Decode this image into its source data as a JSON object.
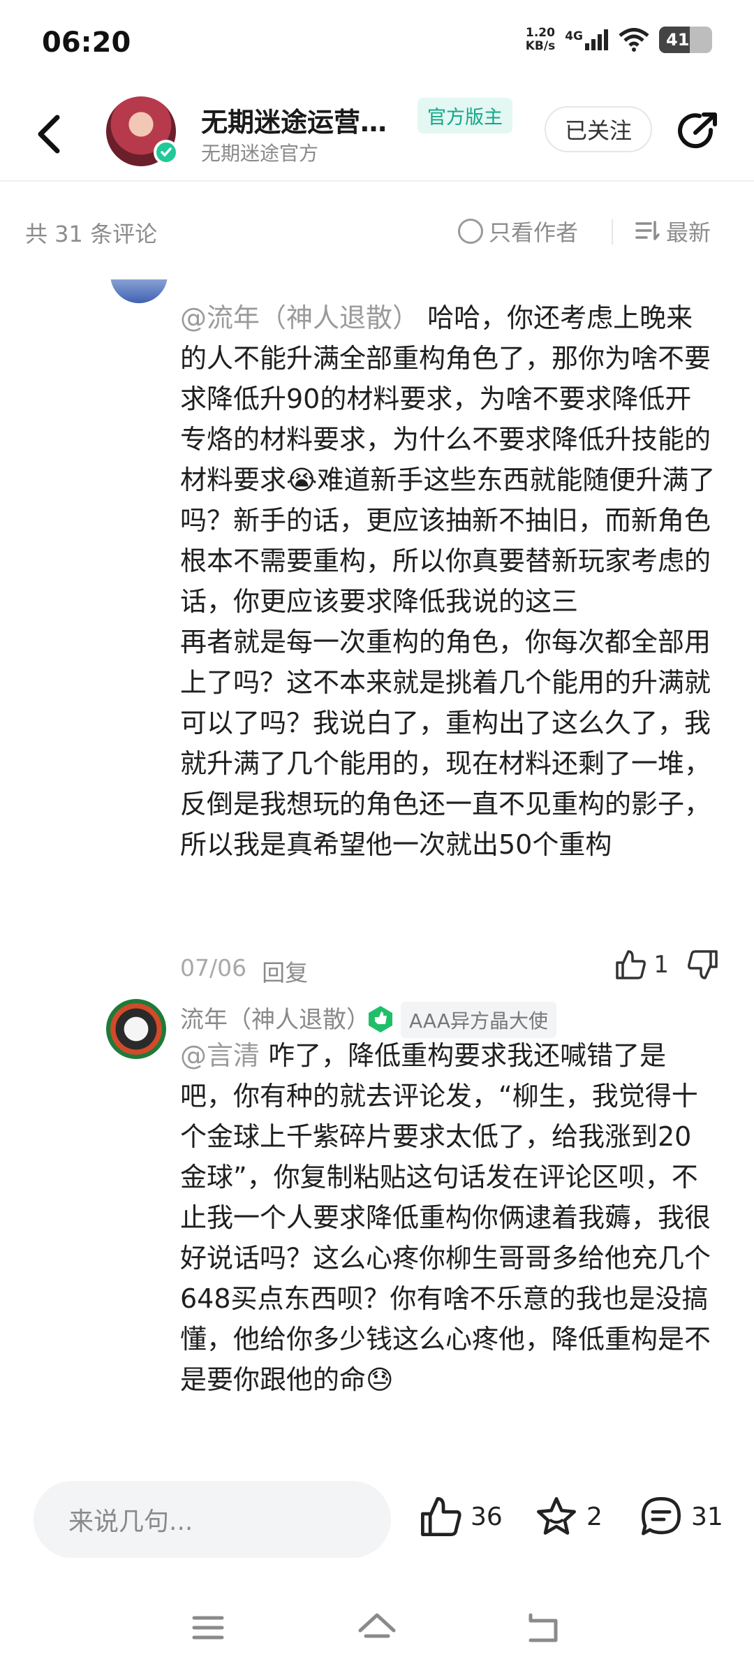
{
  "status_bar": {
    "time": "06:20",
    "net_speed_value": "1.20",
    "net_speed_unit": "KB/s",
    "network": "4G",
    "battery": "41"
  },
  "header": {
    "title": "无期迷途运营…",
    "badge": "官方版主",
    "subtitle": "无期迷途官方",
    "follow_label": "已关注"
  },
  "filter": {
    "count": "共 31 条评论",
    "author_only": "只看作者",
    "sort": "最新"
  },
  "comments": [
    {
      "mention": "@流年（神人退散）",
      "text": "哈哈，你还考虑上晚来的人不能升满全部重构角色了，那你为啥不要求降低升90的材料要求，为啥不要求降低开专烙的材料要求，为什么不要求降低升技能的材料要求😭难道新手这些东西就能随便升满了吗？新手的话，更应该抽新不抽旧，而新角色根本不需要重构，所以你真要替新玩家考虑的话，你更应该要求降低我说的这三",
      "text2": "再者就是每一次重构的角色，你每次都全部用上了吗？这不本来就是挑着几个能用的升满就可以了吗？我说白了，重构出了这么久了，我就升满了几个能用的，现在材料还剩了一堆，反倒是我想玩的角色还一直不见重构的影子，所以我是真希望他一次就出50个重构",
      "date": "07/06",
      "reply_label": "回复",
      "likes": "1"
    },
    {
      "author": "流年（神人退散）",
      "tag": "AAA异方晶大使",
      "mention": "@言清",
      "text": "咋了，降低重构要求我还喊错了是吧，你有种的就去评论发，“柳生，我觉得十个金球上千紫碎片要求太低了，给我涨到20金球”，你复制粘贴这句话发在评论区呗，不止我一个人要求降低重构你俩逮着我薅，我很好说话吗？这么心疼你柳生哥哥多给他充几个648买点东西呗？你有啥不乐意的我也是没搞懂，他给你多少钱这么心疼他，降低重构是不是要你跟他的命😓"
    }
  ],
  "bottom_bar": {
    "input_placeholder": "来说几句...",
    "likes": "36",
    "favorites": "2",
    "comments": "31"
  },
  "colors": {
    "accent": "#12a889",
    "verify": "#20c997",
    "level_green": "#1fbf6a",
    "muted": "#8c8c8c"
  },
  "icons": [
    "back-icon",
    "share-icon",
    "verified-icon",
    "radio-icon",
    "sort-icon",
    "thumb-up-icon",
    "thumb-down-icon",
    "level-icon",
    "star-icon",
    "comment-icon",
    "menu-icon",
    "home-icon",
    "back-nav-icon"
  ]
}
